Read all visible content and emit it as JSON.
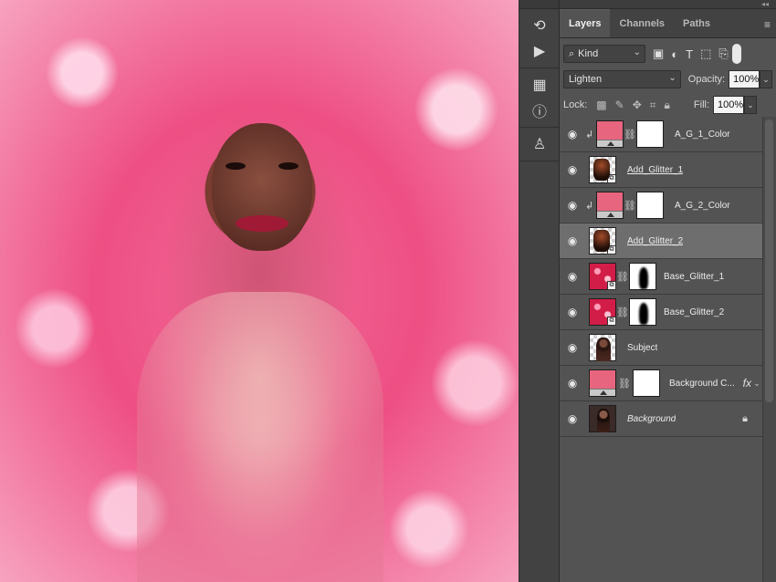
{
  "panel": {
    "tabs": [
      {
        "label": "Layers",
        "active": true
      },
      {
        "label": "Channels",
        "active": false
      },
      {
        "label": "Paths",
        "active": false
      }
    ],
    "filter": {
      "label": "Kind"
    },
    "blend_mode": "Lighten",
    "opacity_label": "Opacity:",
    "opacity_value": "100%",
    "lock_label": "Lock:",
    "fill_label": "Fill:",
    "fill_value": "100%"
  },
  "layers": [
    {
      "name": "A_G_1_Color",
      "thumb": "pink",
      "adjustment": true,
      "clipped": true,
      "mask": "white",
      "underline": false,
      "italic": false,
      "selected": false
    },
    {
      "name": "Add_Glitter_1",
      "thumb": "dark",
      "smart": true,
      "clipped": false,
      "mask": null,
      "underline": true,
      "italic": false,
      "selected": false
    },
    {
      "name": "A_G_2_Color",
      "thumb": "pink",
      "adjustment": true,
      "clipped": true,
      "mask": "white",
      "underline": false,
      "italic": false,
      "selected": false
    },
    {
      "name": "Add_Glitter_2",
      "thumb": "dark",
      "smart": true,
      "clipped": false,
      "mask": null,
      "underline": true,
      "italic": false,
      "selected": true
    },
    {
      "name": "Base_Glitter_1",
      "thumb": "glitter",
      "smart": true,
      "clipped": false,
      "mask": "shape",
      "underline": false,
      "italic": false,
      "selected": false
    },
    {
      "name": "Base_Glitter_2",
      "thumb": "glitter",
      "smart": true,
      "clipped": false,
      "mask": "shape",
      "underline": false,
      "italic": false,
      "selected": false
    },
    {
      "name": "Subject",
      "thumb": "subject",
      "clipped": false,
      "mask": null,
      "underline": false,
      "italic": false,
      "selected": false
    },
    {
      "name": "Background C...",
      "thumb": "pink",
      "adjustment": true,
      "clipped": false,
      "mask": "white",
      "fx": "fx",
      "underline": false,
      "italic": false,
      "selected": false
    },
    {
      "name": "Background",
      "thumb": "bg",
      "clipped": false,
      "mask": null,
      "underline": false,
      "italic": true,
      "locked": true,
      "selected": false
    }
  ],
  "icons": {
    "eye": "eye-icon",
    "link": "chain-link-icon",
    "lock": "lock-icon",
    "fx": "fx-icon"
  },
  "colors": {
    "panel_bg": "#535353",
    "selected_row": "#6e6e6e",
    "accent_pink": "#e7657e"
  }
}
